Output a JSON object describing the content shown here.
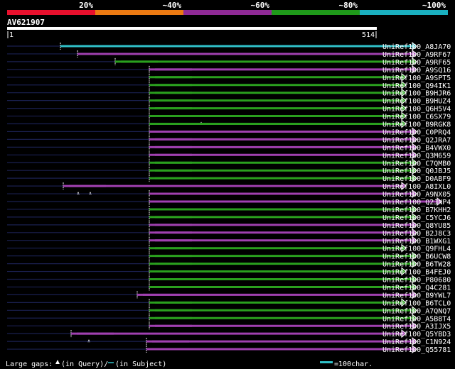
{
  "chart_data": {
    "type": "alignment",
    "query_name": "AV621907",
    "query_start": "1",
    "query_end": "514",
    "query_length": 514,
    "identity_legend": [
      {
        "label": "20%",
        "color": "#e8102d"
      },
      {
        "label": "~40%",
        "color": "#ec7a12"
      },
      {
        "label": "~60%",
        "color": "#8f2a96"
      },
      {
        "label": "~80%",
        "color": "#1f9a1a"
      },
      {
        "label": "~100%",
        "color": "#1ab0c0"
      }
    ],
    "colors": {
      "background": "#000000",
      "ruler": "#ffffff",
      "gap_line": "#1a2050",
      "purple": "#a040b0",
      "green": "#2aa01e",
      "cyan": "#30c0c8",
      "arrow": "#ffffff"
    },
    "hits": [
      {
        "name": "UniRef100_A8JA70",
        "color": "cyan",
        "qstart": 85,
        "qend": 580,
        "sstart": 1,
        "send": 590,
        "query_gaps": []
      },
      {
        "name": "UniRef100_A9RF67",
        "color": "purple",
        "qstart": 109,
        "qend": 580,
        "sstart": 80,
        "send": 590,
        "query_gaps": []
      },
      {
        "name": "UniRef100_A9RF65",
        "color": "green",
        "qstart": 162,
        "qend": 580,
        "sstart": 100,
        "send": 590,
        "query_gaps": []
      },
      {
        "name": "UniRef100_A9SQ16",
        "color": "purple",
        "qstart": 210,
        "qend": 580,
        "sstart": 140,
        "send": 590,
        "query_gaps": []
      },
      {
        "name": "UniRef100_A9SPT5",
        "color": "green",
        "qstart": 210,
        "qend": 565,
        "sstart": 140,
        "send": 590,
        "query_gaps": []
      },
      {
        "name": "UniRef100_Q94IK1",
        "color": "green",
        "qstart": 210,
        "qend": 565,
        "sstart": 140,
        "send": 590,
        "query_gaps": []
      },
      {
        "name": "UniRef100_B9HJR6",
        "color": "green",
        "qstart": 210,
        "qend": 565,
        "sstart": 140,
        "send": 590,
        "query_gaps": []
      },
      {
        "name": "UniRef100_B9HUZ4",
        "color": "green",
        "qstart": 210,
        "qend": 565,
        "sstart": 140,
        "send": 590,
        "query_gaps": []
      },
      {
        "name": "UniRef100_Q6H5V4",
        "color": "green",
        "qstart": 210,
        "qend": 565,
        "sstart": 140,
        "send": 590,
        "query_gaps": []
      },
      {
        "name": "UniRef100_C6SX79",
        "color": "green",
        "qstart": 210,
        "qend": 565,
        "sstart": 140,
        "send": 590,
        "query_gaps": [
          283
        ]
      },
      {
        "name": "UniRef100_B9RGK8",
        "color": "green",
        "qstart": 210,
        "qend": 565,
        "sstart": 140,
        "send": 590,
        "query_gaps": []
      },
      {
        "name": "UniRef100_C0PRQ4",
        "color": "purple",
        "qstart": 210,
        "qend": 580,
        "sstart": 140,
        "send": 590,
        "query_gaps": []
      },
      {
        "name": "UniRef100_Q2JRA7",
        "color": "purple",
        "qstart": 210,
        "qend": 580,
        "sstart": 140,
        "send": 590,
        "query_gaps": []
      },
      {
        "name": "UniRef100_B4VWX0",
        "color": "purple",
        "qstart": 210,
        "qend": 580,
        "sstart": 140,
        "send": 590,
        "query_gaps": []
      },
      {
        "name": "UniRef100_Q3M659",
        "color": "purple",
        "qstart": 210,
        "qend": 580,
        "sstart": 140,
        "send": 590,
        "query_gaps": []
      },
      {
        "name": "UniRef100_C7QMB0",
        "color": "green",
        "qstart": 210,
        "qend": 580,
        "sstart": 140,
        "send": 590,
        "query_gaps": []
      },
      {
        "name": "UniRef100_Q0JBJ5",
        "color": "green",
        "qstart": 210,
        "qend": 580,
        "sstart": 140,
        "send": 590,
        "query_gaps": []
      },
      {
        "name": "UniRef100_D0ABF9",
        "color": "green",
        "qstart": 210,
        "qend": 580,
        "sstart": 140,
        "send": 590,
        "query_gaps": []
      },
      {
        "name": "UniRef100_A8IXL0",
        "color": "purple",
        "qstart": 89,
        "qend": 565,
        "sstart": 0,
        "send": 590,
        "query_gaps": [
          110,
          127
        ]
      },
      {
        "name": "UniRef100_A9NX05",
        "color": "purple",
        "qstart": 210,
        "qend": 580,
        "sstart": 140,
        "send": 590,
        "query_gaps": []
      },
      {
        "name": "UniRef100_Q2JNP4",
        "color": "purple",
        "qstart": 210,
        "qend": 615,
        "sstart": 140,
        "send": 615,
        "query_gaps": []
      },
      {
        "name": "UniRef100_B7KHH2",
        "color": "green",
        "qstart": 210,
        "qend": 580,
        "sstart": 140,
        "send": 590,
        "query_gaps": []
      },
      {
        "name": "UniRef100_C5YCJ6",
        "color": "green",
        "qstart": 210,
        "qend": 580,
        "sstart": 140,
        "send": 590,
        "query_gaps": []
      },
      {
        "name": "UniRef100_Q8YU85",
        "color": "purple",
        "qstart": 210,
        "qend": 580,
        "sstart": 140,
        "send": 590,
        "query_gaps": []
      },
      {
        "name": "UniRef100_B2J8C3",
        "color": "purple",
        "qstart": 210,
        "qend": 580,
        "sstart": 140,
        "send": 590,
        "query_gaps": []
      },
      {
        "name": "UniRef100_B1WXG1",
        "color": "purple",
        "qstart": 210,
        "qend": 580,
        "sstart": 140,
        "send": 590,
        "query_gaps": []
      },
      {
        "name": "UniRef100_Q9FHL4",
        "color": "green",
        "qstart": 210,
        "qend": 565,
        "sstart": 140,
        "send": 590,
        "query_gaps": []
      },
      {
        "name": "UniRef100_B6UCW8",
        "color": "green",
        "qstart": 210,
        "qend": 580,
        "sstart": 140,
        "send": 590,
        "query_gaps": []
      },
      {
        "name": "UniRef100_B6TW28",
        "color": "green",
        "qstart": 210,
        "qend": 580,
        "sstart": 140,
        "send": 590,
        "query_gaps": []
      },
      {
        "name": "UniRef100_B4FEJ0",
        "color": "green",
        "qstart": 210,
        "qend": 565,
        "sstart": 140,
        "send": 590,
        "query_gaps": []
      },
      {
        "name": "UniRef100_P80680",
        "color": "green",
        "qstart": 210,
        "qend": 580,
        "sstart": 140,
        "send": 590,
        "query_gaps": []
      },
      {
        "name": "UniRef100_Q4C281",
        "color": "green",
        "qstart": 210,
        "qend": 580,
        "sstart": 140,
        "send": 590,
        "query_gaps": []
      },
      {
        "name": "UniRef100_B9YWL7",
        "color": "purple",
        "qstart": 193,
        "qend": 580,
        "sstart": 110,
        "send": 590,
        "query_gaps": []
      },
      {
        "name": "UniRef100_B6TCL0",
        "color": "green",
        "qstart": 210,
        "qend": 565,
        "sstart": 140,
        "send": 590,
        "query_gaps": []
      },
      {
        "name": "UniRef100_A7QNQ7",
        "color": "green",
        "qstart": 210,
        "qend": 580,
        "sstart": 140,
        "send": 590,
        "query_gaps": []
      },
      {
        "name": "UniRef100_A5B8T4",
        "color": "green",
        "qstart": 210,
        "qend": 580,
        "sstart": 140,
        "send": 590,
        "query_gaps": []
      },
      {
        "name": "UniRef100_A3IJX5",
        "color": "purple",
        "qstart": 210,
        "qend": 580,
        "sstart": 140,
        "send": 590,
        "query_gaps": []
      },
      {
        "name": "UniRef100_Q5YBD3",
        "color": "purple",
        "qstart": 100,
        "qend": 565,
        "sstart": 40,
        "send": 590,
        "query_gaps": [
          125
        ]
      },
      {
        "name": "UniRef100_C1N924",
        "color": "purple",
        "qstart": 206,
        "qend": 580,
        "sstart": 140,
        "send": 590,
        "query_gaps": []
      },
      {
        "name": "UniRef100_Q55781",
        "color": "purple",
        "qstart": 206,
        "qend": 580,
        "sstart": 140,
        "send": 590,
        "query_gaps": []
      }
    ],
    "footer": {
      "gaps_label_prefix": "Large gaps:",
      "gaps_label_query": "(in Query)/",
      "gaps_label_subject": "(in Subject)",
      "scale_label": "=100char."
    }
  }
}
